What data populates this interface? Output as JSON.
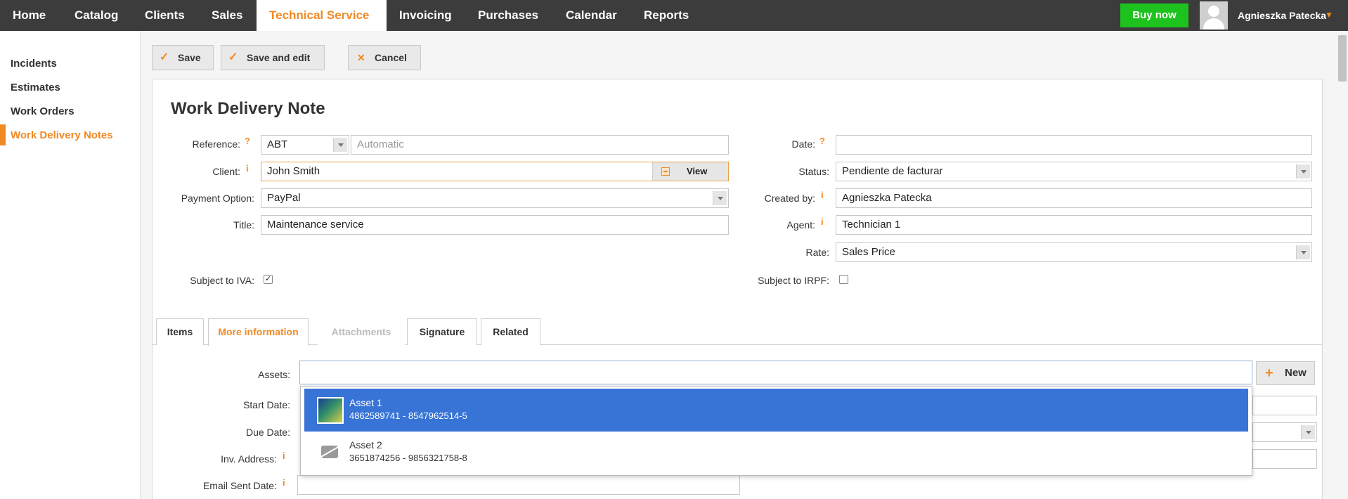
{
  "nav": {
    "items": [
      {
        "label": "Home"
      },
      {
        "label": "Catalog"
      },
      {
        "label": "Clients"
      },
      {
        "label": "Sales"
      },
      {
        "label": "Technical Service",
        "active": true
      },
      {
        "label": "Invoicing"
      },
      {
        "label": "Purchases"
      },
      {
        "label": "Calendar"
      },
      {
        "label": "Reports"
      }
    ],
    "buy_now": "Buy now",
    "user_name": "Agnieszka Patecka"
  },
  "sidebar": {
    "items": [
      {
        "label": "Incidents"
      },
      {
        "label": "Estimates"
      },
      {
        "label": "Work Orders"
      },
      {
        "label": "Work Delivery Notes",
        "active": true
      }
    ]
  },
  "toolbar": {
    "save": "Save",
    "save_edit": "Save and edit",
    "cancel": "Cancel"
  },
  "form": {
    "title": "Work Delivery Note",
    "reference_label": "Reference:",
    "reference_series": "ABT",
    "reference_placeholder": "Automatic",
    "client_label": "Client:",
    "client_value": "John Smith",
    "view_label": "View",
    "payment_label": "Payment Option:",
    "payment_value": "PayPal",
    "title_label": "Title:",
    "title_value": "Maintenance service",
    "iva_label": "Subject to IVA:",
    "date_label": "Date:",
    "date_value": "",
    "status_label": "Status:",
    "status_value": "Pendiente de facturar",
    "created_label": "Created by:",
    "created_value": "Agnieszka Patecka",
    "agent_label": "Agent:",
    "agent_value": "Technician 1",
    "rate_label": "Rate:",
    "rate_value": "Sales Price",
    "irpf_label": "Subject to IRPF:"
  },
  "tabs": [
    {
      "label": "Items"
    },
    {
      "label": "More information",
      "active": true
    },
    {
      "label": "Attachments",
      "disabled": true
    },
    {
      "label": "Signature"
    },
    {
      "label": "Related"
    }
  ],
  "more_info": {
    "assets_label": "Assets:",
    "new_label": "New",
    "start_date_label": "Start Date:",
    "due_date_label": "Due Date:",
    "inv_address_label": "Inv. Address:",
    "email_sent_label": "Email Sent Date:"
  },
  "dropdown": {
    "items": [
      {
        "name": "Asset 1",
        "codes": "4862589741 - 8547962514-5"
      },
      {
        "name": "Asset 2",
        "codes": "3651874256 - 9856321758-8"
      }
    ]
  },
  "colors": {
    "accent": "#f08a24",
    "nav_bg": "#3c3c3c",
    "buy_green": "#1ec21e",
    "selection_blue": "#3874d6"
  }
}
